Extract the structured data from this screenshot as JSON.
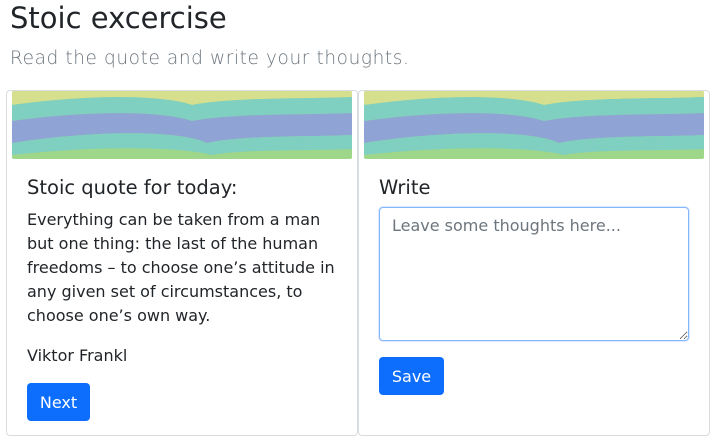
{
  "header": {
    "title": "Stoic excercise",
    "subtitle": "Read the quote and write your thoughts."
  },
  "quote_card": {
    "heading": "Stoic quote for today:",
    "quote": "Everything can be taken from a man but one thing: the last of the human freedoms – to choose one’s attitude in any given set of circumstances, to choose one’s own way.",
    "author": "Viktor Frankl",
    "next_label": "Next"
  },
  "write_card": {
    "heading": "Write",
    "textarea_value": "",
    "placeholder": "Leave some thoughts here...",
    "save_label": "Save"
  },
  "colors": {
    "primary": "#0d6efd",
    "banner_blue": "#8fa4d4",
    "banner_teal": "#7fd0c0",
    "banner_green": "#9ed68a",
    "banner_yellow": "#d6df8e"
  }
}
